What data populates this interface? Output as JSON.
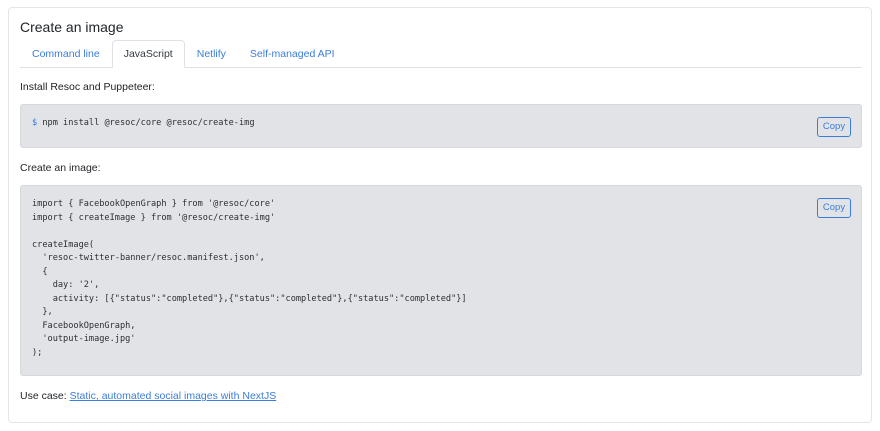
{
  "card": {
    "title": "Create an image"
  },
  "tabs": [
    {
      "label": "Command line",
      "active": false
    },
    {
      "label": "JavaScript",
      "active": true
    },
    {
      "label": "Netlify",
      "active": false
    },
    {
      "label": "Self-managed API",
      "active": false
    }
  ],
  "install": {
    "label": "Install Resoc and Puppeteer:",
    "prompt": "$",
    "command": " npm install @resoc/core @resoc/create-img",
    "copy_label": "Copy"
  },
  "create": {
    "label": "Create an image:",
    "lines": [
      "import { FacebookOpenGraph } from '@resoc/core'",
      "import { createImage } from '@resoc/create-img'",
      "",
      "createImage(",
      "  'resoc-twitter-banner/resoc.manifest.json',",
      "  {",
      "    day: '2',",
      "    activity: [{\"status\":\"completed\"},{\"status\":\"completed\"},{\"status\":\"completed\"}]",
      "  },",
      "  FacebookOpenGraph,",
      "  'output-image.jpg'",
      ");"
    ],
    "copy_label": "Copy"
  },
  "use_case": {
    "prefix": "Use case: ",
    "link_text": "Static, automated social images with NextJS"
  },
  "colors": {
    "accent": "#3b7ddd",
    "code_background": "#e1e3e6",
    "text": "#212529"
  }
}
